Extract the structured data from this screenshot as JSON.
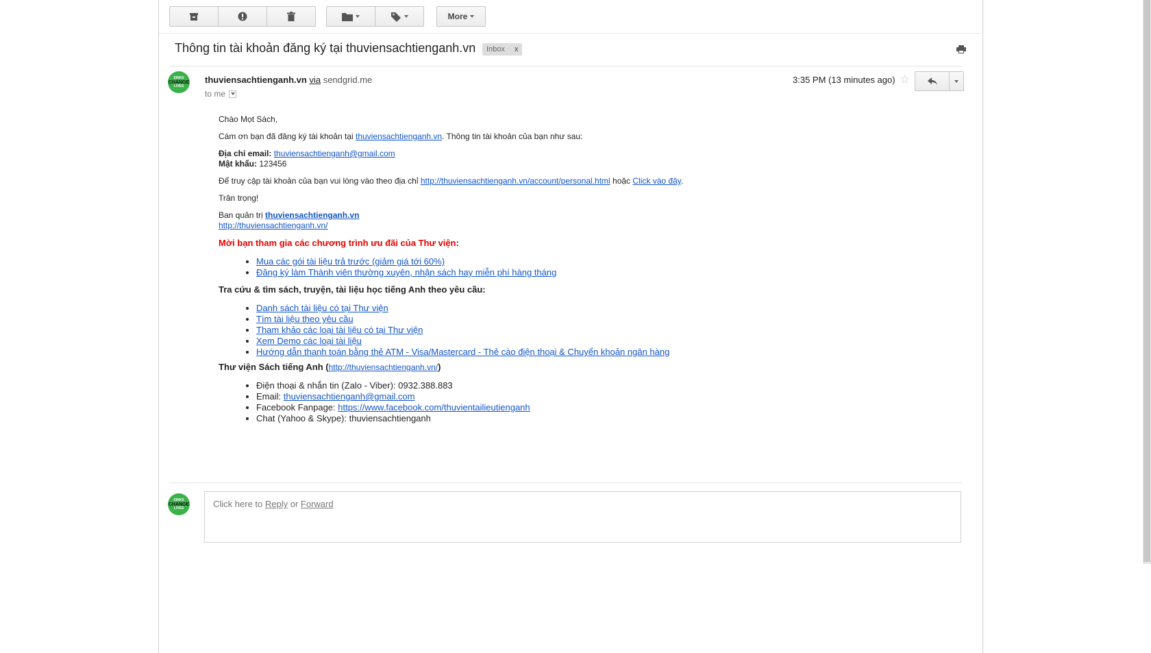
{
  "toolbar": {
    "archive_icon": "archive-icon",
    "spam_icon": "report-spam-icon",
    "delete_icon": "trash-icon",
    "move_icon": "folder-icon",
    "labels_icon": "label-icon",
    "more_label": "More"
  },
  "thread": {
    "subject": "Thông tin tài khoản đăng ký tại thuviensachtienganh.vn",
    "label": "Inbox",
    "label_close": "x"
  },
  "message": {
    "sender_name": "thuviensachtienganh.vn",
    "via": "via",
    "via_domain": "sendgrid.me",
    "to": "to me",
    "time": "3:35 PM (13 minutes ago)",
    "avatar_text": [
      "SINKS",
      "CHANGE",
      "LIVES"
    ]
  },
  "body": {
    "greeting": "Chào Mọt Sách,",
    "thanks_prefix": "Cám ơn bạn đã đăng ký tài khoản tại ",
    "thanks_link": "thuviensachtienganh.vn",
    "thanks_suffix": ". Thông tin tài khoản của bạn như sau:",
    "email_label": "Địa chỉ email:",
    "email_value": "thuviensachtienganh@gmail.com",
    "password_label": "Mật khẩu:",
    "password_value": " 123456",
    "access_prefix": "Để truy cập tài khoản của bạn vui lòng vào theo địa chỉ ",
    "access_link": "http://thuviensachtienganh.vn/account/personal.html",
    "access_mid": " hoặc ",
    "access_click": "Click vào đây",
    "access_end": ".",
    "regards": "Trân trọng!",
    "admin_prefix": "Ban quản trị ",
    "admin_link": "thuviensachtienganh.vn",
    "site_url": "http://thuviensachtienganh.vn/",
    "promo_heading_red": "Mời bạn tham gia các chương trình ưu đãi của Thư viện",
    "promo_heading_colon": ":",
    "promo_items": [
      "Mua các gói tài liệu trả trước (giảm giá tới 60%)",
      "Đăng ký làm Thành viên thường xuyên, nhận sách hay miễn phí hàng tháng"
    ],
    "search_heading": "Tra cứu & tìm sách, truyện, tài liệu học tiếng Anh theo yêu cầu:",
    "search_items": [
      "Danh sách tài liệu có tại Thư viện",
      "Tìm tài liệu theo yêu cầu",
      "Tham khảo các loại tài liệu có tại Thư viện",
      "Xem Demo các loại tài liệu",
      "Hướng dẫn thanh toán bằng thẻ ATM - Visa/Mastercard - Thẻ cào điện thoại & Chuyển khoản ngân hàng"
    ],
    "library_heading": "Thư viện Sách tiếng Anh",
    "library_open": " (",
    "library_link": "http://thuviensachtienganh.vn/",
    "library_close": ")",
    "contact_phone": "Điện thoại & nhắn tin (Zalo - Viber): 0932.388.883",
    "contact_email_label": "Email: ",
    "contact_email": "thuviensachtienganh@gmail.com",
    "contact_fb_label": "Facebook Fanpage: ",
    "contact_fb": "https://www.facebook.com/thuvientailieutienganh",
    "contact_chat": "Chat (Yahoo & Skype): thuviensachtienganh"
  },
  "reply_box": {
    "prefix": "Click here to ",
    "reply": "Reply",
    "or": " or ",
    "forward": "Forward"
  }
}
